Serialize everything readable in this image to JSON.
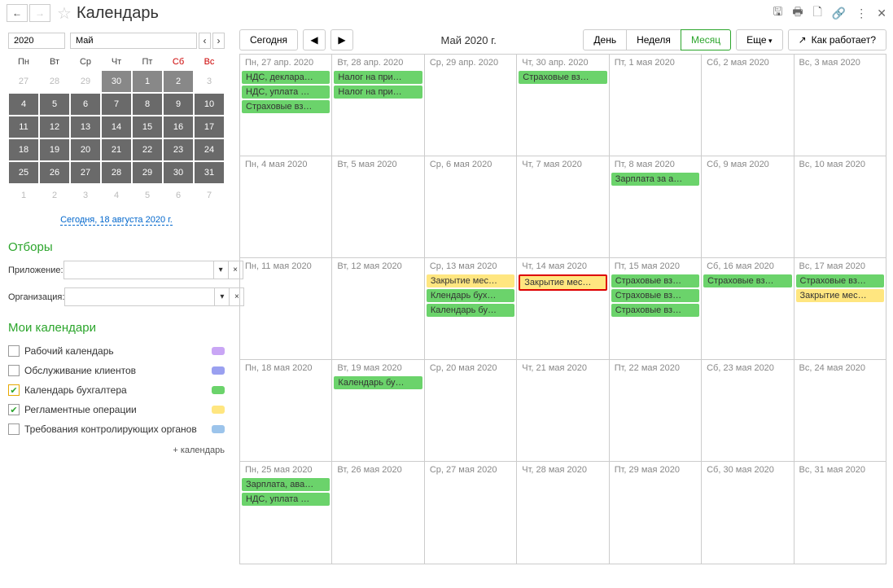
{
  "header": {
    "title": "Календарь"
  },
  "sidebar": {
    "year": "2020",
    "month": "Май",
    "weekdays": [
      "Пн",
      "Вт",
      "Ср",
      "Чт",
      "Пт",
      "Сб",
      "Вс"
    ],
    "minical_rows": [
      [
        {
          "d": "27",
          "cls": "other"
        },
        {
          "d": "28",
          "cls": "other"
        },
        {
          "d": "29",
          "cls": "other"
        },
        {
          "d": "30",
          "cls": "other apr30"
        },
        {
          "d": "1",
          "cls": "may1-2"
        },
        {
          "d": "2",
          "cls": "may1-2"
        },
        {
          "d": "3",
          "cls": "other"
        }
      ],
      [
        {
          "d": "4",
          "cls": "active"
        },
        {
          "d": "5",
          "cls": "active"
        },
        {
          "d": "6",
          "cls": "active"
        },
        {
          "d": "7",
          "cls": "active"
        },
        {
          "d": "8",
          "cls": "active"
        },
        {
          "d": "9",
          "cls": "active"
        },
        {
          "d": "10",
          "cls": "active"
        }
      ],
      [
        {
          "d": "11",
          "cls": "active"
        },
        {
          "d": "12",
          "cls": "active"
        },
        {
          "d": "13",
          "cls": "active"
        },
        {
          "d": "14",
          "cls": "active"
        },
        {
          "d": "15",
          "cls": "active"
        },
        {
          "d": "16",
          "cls": "active"
        },
        {
          "d": "17",
          "cls": "active"
        }
      ],
      [
        {
          "d": "18",
          "cls": "active"
        },
        {
          "d": "19",
          "cls": "active"
        },
        {
          "d": "20",
          "cls": "active"
        },
        {
          "d": "21",
          "cls": "active"
        },
        {
          "d": "22",
          "cls": "active"
        },
        {
          "d": "23",
          "cls": "active"
        },
        {
          "d": "24",
          "cls": "active"
        }
      ],
      [
        {
          "d": "25",
          "cls": "active"
        },
        {
          "d": "26",
          "cls": "active"
        },
        {
          "d": "27",
          "cls": "active"
        },
        {
          "d": "28",
          "cls": "active"
        },
        {
          "d": "29",
          "cls": "active"
        },
        {
          "d": "30",
          "cls": "active"
        },
        {
          "d": "31",
          "cls": "active"
        }
      ],
      [
        {
          "d": "1",
          "cls": "other"
        },
        {
          "d": "2",
          "cls": "other"
        },
        {
          "d": "3",
          "cls": "other"
        },
        {
          "d": "4",
          "cls": "other"
        },
        {
          "d": "5",
          "cls": "other"
        },
        {
          "d": "6",
          "cls": "other"
        },
        {
          "d": "7",
          "cls": "other"
        }
      ]
    ],
    "today_link": "Сегодня, 18 августа 2020 г.",
    "filters_title": "Отборы",
    "filter_app_label": "Приложение:",
    "filter_org_label": "Организация:",
    "cals_title": "Мои календари",
    "calendars": [
      {
        "label": "Рабочий календарь",
        "checked": false,
        "highlighted": false,
        "color": "#c9a6f5"
      },
      {
        "label": "Обслуживание клиентов",
        "checked": false,
        "highlighted": false,
        "color": "#9aa0f0"
      },
      {
        "label": "Календарь бухгалтера",
        "checked": true,
        "highlighted": true,
        "color": "#6bd36b"
      },
      {
        "label": "Регламентные операции",
        "checked": true,
        "highlighted": false,
        "color": "#ffe680"
      },
      {
        "label": "Требования контролирующих органов",
        "checked": false,
        "highlighted": false,
        "color": "#9cc4eb"
      }
    ],
    "add_cal": "+ календарь"
  },
  "toolbar": {
    "today": "Сегодня",
    "month_label": "Май 2020 г.",
    "day": "День",
    "week": "Неделя",
    "month": "Месяц",
    "more": "Еще",
    "help": "Как работает?"
  },
  "grid": {
    "rows": [
      {
        "cells": [
          {
            "hdr": "Пн, 27 апр. 2020",
            "events": [
              {
                "t": "НДС, деклара…",
                "c": "ev-green"
              },
              {
                "t": "НДС, уплата …",
                "c": "ev-green"
              },
              {
                "t": "Страховые вз…",
                "c": "ev-green"
              }
            ]
          },
          {
            "hdr": "Вт, 28 апр. 2020",
            "events": [
              {
                "t": "Налог на при…",
                "c": "ev-green"
              },
              {
                "t": "Налог на при…",
                "c": "ev-green"
              }
            ]
          },
          {
            "hdr": "Ср, 29 апр. 2020",
            "events": []
          },
          {
            "hdr": "Чт, 30 апр. 2020",
            "events": [
              {
                "t": "Страховые вз…",
                "c": "ev-green"
              }
            ]
          },
          {
            "hdr": "Пт, 1 мая 2020",
            "events": []
          },
          {
            "hdr": "Сб, 2 мая 2020",
            "events": []
          },
          {
            "hdr": "Вс, 3 мая 2020",
            "events": []
          }
        ]
      },
      {
        "cells": [
          {
            "hdr": "Пн, 4 мая 2020",
            "events": []
          },
          {
            "hdr": "Вт, 5 мая 2020",
            "events": []
          },
          {
            "hdr": "Ср, 6 мая 2020",
            "events": []
          },
          {
            "hdr": "Чт, 7 мая 2020",
            "events": []
          },
          {
            "hdr": "Пт, 8 мая 2020",
            "events": [
              {
                "t": "Зарплата за а…",
                "c": "ev-green"
              }
            ]
          },
          {
            "hdr": "Сб, 9 мая 2020",
            "events": []
          },
          {
            "hdr": "Вс, 10 мая 2020",
            "events": []
          }
        ]
      },
      {
        "cells": [
          {
            "hdr": "Пн, 11 мая 2020",
            "events": []
          },
          {
            "hdr": "Вт, 12 мая 2020",
            "events": []
          },
          {
            "hdr": "Ср, 13 мая 2020",
            "events": [
              {
                "t": "Закрытие мес…",
                "c": "ev-yellow"
              },
              {
                "t": "Клендарь бух…",
                "c": "ev-green"
              },
              {
                "t": "Календарь бу…",
                "c": "ev-green"
              }
            ]
          },
          {
            "hdr": "Чт, 14 мая 2020",
            "events": [
              {
                "t": "Закрытие мес…",
                "c": "ev-red-border"
              }
            ]
          },
          {
            "hdr": "Пт, 15 мая 2020",
            "events": [
              {
                "t": "Страховые вз…",
                "c": "ev-green"
              },
              {
                "t": "Страховые вз…",
                "c": "ev-green"
              },
              {
                "t": "Страховые вз…",
                "c": "ev-green"
              }
            ]
          },
          {
            "hdr": "Сб, 16 мая 2020",
            "events": [
              {
                "t": "Страховые вз…",
                "c": "ev-green"
              }
            ]
          },
          {
            "hdr": "Вс, 17 мая 2020",
            "events": [
              {
                "t": "Страховые вз…",
                "c": "ev-green"
              },
              {
                "t": "Закрытие мес…",
                "c": "ev-yellow"
              }
            ]
          }
        ]
      },
      {
        "cells": [
          {
            "hdr": "Пн, 18 мая 2020",
            "events": []
          },
          {
            "hdr": "Вт, 19 мая 2020",
            "events": [
              {
                "t": "Календарь бу…",
                "c": "ev-green"
              }
            ]
          },
          {
            "hdr": "Ср, 20 мая 2020",
            "events": []
          },
          {
            "hdr": "Чт, 21 мая 2020",
            "events": []
          },
          {
            "hdr": "Пт, 22 мая 2020",
            "events": []
          },
          {
            "hdr": "Сб, 23 мая 2020",
            "events": []
          },
          {
            "hdr": "Вс, 24 мая 2020",
            "events": []
          }
        ]
      },
      {
        "cells": [
          {
            "hdr": "Пн, 25 мая 2020",
            "events": [
              {
                "t": "Зарплата, ава…",
                "c": "ev-green"
              },
              {
                "t": "НДС, уплата …",
                "c": "ev-green"
              }
            ]
          },
          {
            "hdr": "Вт, 26 мая 2020",
            "events": []
          },
          {
            "hdr": "Ср, 27 мая 2020",
            "events": []
          },
          {
            "hdr": "Чт, 28 мая 2020",
            "events": []
          },
          {
            "hdr": "Пт, 29 мая 2020",
            "events": []
          },
          {
            "hdr": "Сб, 30 мая 2020",
            "events": []
          },
          {
            "hdr": "Вс, 31 мая 2020",
            "events": []
          }
        ]
      }
    ]
  }
}
